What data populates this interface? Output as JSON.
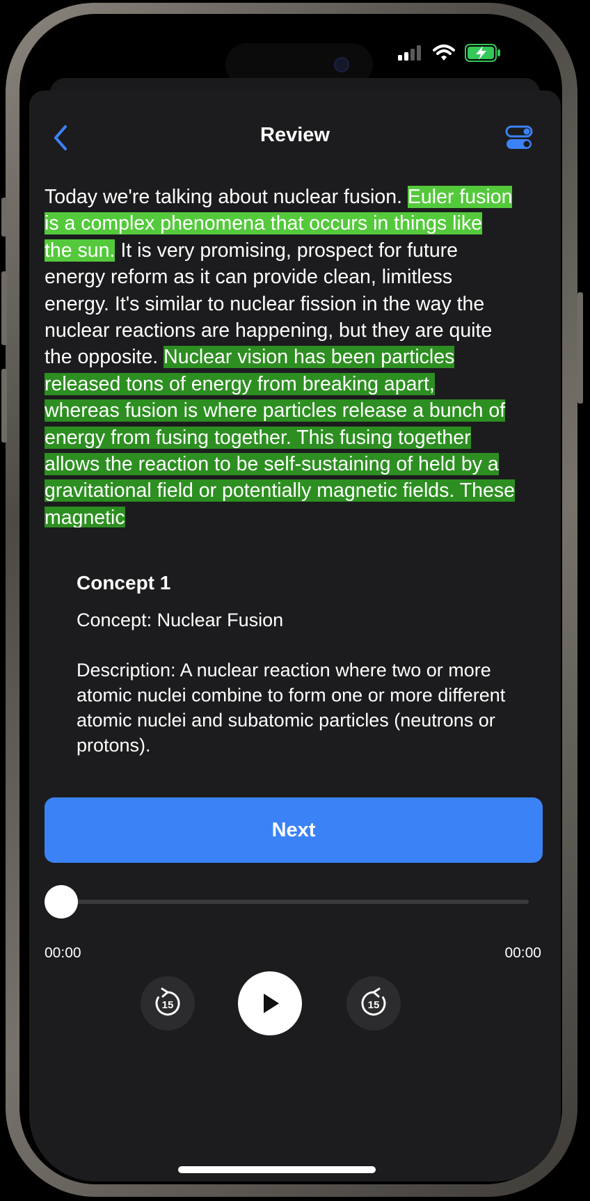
{
  "header": {
    "title": "Review",
    "back_icon": "chevron-left-icon",
    "settings_icon": "toggle-icon",
    "accent": "#3b82f6"
  },
  "status_bar": {
    "signal_icon": "cellular-signal-icon",
    "wifi_icon": "wifi-icon",
    "battery_icon": "battery-charging-icon",
    "battery_color": "#34c759"
  },
  "transcript": {
    "highlight_light": "#54c93c",
    "highlight_dark": "#2d8f21",
    "segments": [
      {
        "text": " Today we're talking about nuclear fusion.  ",
        "highlight": "none"
      },
      {
        "text": "Euler fusion is a complex phenomena that occurs in things like the sun.",
        "highlight": "light"
      },
      {
        "text": " It is very promising, prospect for future energy reform as it can provide clean, limitless energy.  It's similar to nuclear fission in the way the nuclear reactions are happening, but they are quite the opposite.  ",
        "highlight": "none"
      },
      {
        "text": "Nuclear vision has been particles released tons of energy from breaking apart, whereas fusion is where particles release a bunch of energy from fusing together. This fusing together allows the reaction to be self-sustaining of held by a gravitational field or potentially magnetic fields.  These magnetic",
        "highlight": "dark"
      }
    ]
  },
  "concept": {
    "heading": "Concept 1",
    "name": "Concept: Nuclear Fusion",
    "description": "Description: A nuclear reaction where two or more atomic nuclei combine to form one or more different atomic nuclei and subatomic particles (neutrons or protons)."
  },
  "next_button": {
    "label": "Next"
  },
  "player": {
    "elapsed": "00:00",
    "total": "00:00",
    "progress": 0,
    "skip_back_label": "15",
    "skip_forward_label": "15",
    "play_icon": "play-icon",
    "skip_back_icon": "rewind-15-icon",
    "skip_forward_icon": "forward-15-icon"
  }
}
